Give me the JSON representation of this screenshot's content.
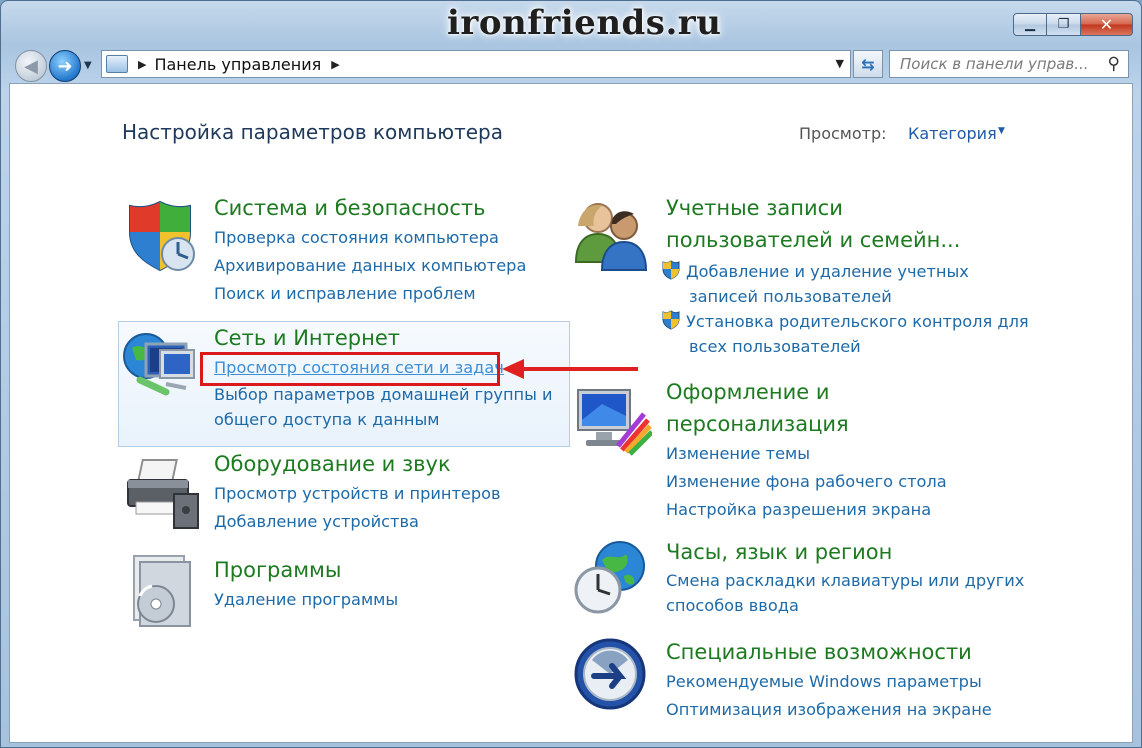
{
  "window": {
    "watermark": "ironfriends.ru",
    "minimize_glyph": "▁",
    "maximize_glyph": "❐",
    "close_glyph": "✕"
  },
  "nav": {
    "back_glyph": "◀",
    "forward_glyph": "➜",
    "address_path": "Панель управления",
    "search_placeholder": "Поиск в панели управ..."
  },
  "page": {
    "title": "Настройка параметров компьютера",
    "view_label": "Просмотр:",
    "view_value": "Категория"
  },
  "left_categories": [
    {
      "title": "Система и безопасность",
      "icon": "shield-icon",
      "links": [
        "Проверка состояния компьютера",
        "Архивирование данных компьютера",
        "Поиск и исправление проблем"
      ]
    },
    {
      "title": "Сеть и Интернет",
      "icon": "network-globe-icon",
      "links": [
        "Просмотр состояния сети и задач",
        "Выбор параметров домашней группы и",
        "общего доступа к данным"
      ]
    },
    {
      "title": "Оборудование и звук",
      "icon": "printer-icon",
      "links": [
        "Просмотр устройств и принтеров",
        "Добавление устройства"
      ]
    },
    {
      "title": "Программы",
      "icon": "programs-disc-icon",
      "links": [
        "Удаление программы"
      ]
    }
  ],
  "right_categories": [
    {
      "title_line1": "Учетные записи",
      "title_line2": "пользователей и семейн...",
      "icon": "users-icon",
      "links": [
        {
          "line1": "Добавление и удаление учетных",
          "line2": "записей пользователей",
          "icon": "uac-shield-icon"
        },
        {
          "line1": "Установка родительского контроля для",
          "line2": "всех пользователей",
          "icon": "uac-shield-icon"
        }
      ]
    },
    {
      "title_line1": "Оформление и",
      "title_line2": "персонализация",
      "icon": "monitor-palette-icon",
      "links": [
        "Изменение темы",
        "Изменение фона рабочего стола",
        "Настройка разрешения экрана"
      ]
    },
    {
      "title_line1": "Часы, язык и регион",
      "icon": "clock-globe-icon",
      "links": [
        "Смена раскладки клавиатуры или других",
        "способов ввода"
      ]
    },
    {
      "title_line1": "Специальные возможности",
      "icon": "accessibility-icon",
      "links": [
        "Рекомендуемые Windows параметры",
        "Оптимизация изображения на экране"
      ]
    }
  ],
  "colors": {
    "category_title": "#1d7a20",
    "link": "#1e6aa8",
    "annotation_red": "#d9191c"
  }
}
